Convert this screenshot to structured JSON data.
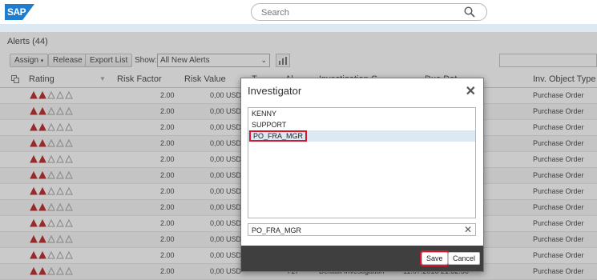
{
  "header": {
    "search_placeholder": "Search",
    "logo_text": "SAP"
  },
  "alerts": {
    "title": "Alerts (44)"
  },
  "toolbar": {
    "assign": "Assign",
    "release": "Release",
    "export": "Export List",
    "show_label": "Show:",
    "show_value": "All New Alerts"
  },
  "grid": {
    "headers": {
      "rating": "Rating",
      "risk_factor": "Risk Factor",
      "risk_value": "Risk Value",
      "type": "T",
      "alert": "Al",
      "inv": "Investigation G",
      "due": "Due Dat",
      "obj_type": "Inv. Object Type"
    },
    "rows": [
      {
        "risk_factor": "2.00",
        "risk_value": "0,00 USD",
        "due": "56",
        "obj_type": "Purchase Order"
      },
      {
        "risk_factor": "2.00",
        "risk_value": "0,00 USD",
        "due": "56",
        "obj_type": "Purchase Order"
      },
      {
        "risk_factor": "2.00",
        "risk_value": "0,00 USD",
        "due": "56",
        "obj_type": "Purchase Order"
      },
      {
        "risk_factor": "2.00",
        "risk_value": "0,00 USD",
        "due": "56",
        "obj_type": "Purchase Order"
      },
      {
        "risk_factor": "2.00",
        "risk_value": "0,00 USD",
        "due": "56",
        "obj_type": "Purchase Order"
      },
      {
        "risk_factor": "2.00",
        "risk_value": "0,00 USD",
        "due": "56",
        "obj_type": "Purchase Order"
      },
      {
        "risk_factor": "2.00",
        "risk_value": "0,00 USD",
        "due": "56",
        "obj_type": "Purchase Order"
      },
      {
        "risk_factor": "2.00",
        "risk_value": "0,00 USD",
        "due": "56",
        "obj_type": "Purchase Order"
      },
      {
        "risk_factor": "2.00",
        "risk_value": "0,00 USD",
        "due": "56",
        "obj_type": "Purchase Order"
      },
      {
        "risk_factor": "2.00",
        "risk_value": "0,00 USD",
        "due": "56",
        "obj_type": "Purchase Order"
      },
      {
        "risk_factor": "2.00",
        "risk_value": "0,00 USD",
        "due": "56",
        "obj_type": "Purchase Order"
      },
      {
        "risk_factor": "2.00",
        "risk_value": "0,00 USD",
        "alert": "717",
        "inv": "Default Investigation",
        "due": "11.07.2016 21:32:56",
        "obj_type": "Purchase Order"
      }
    ]
  },
  "dialog": {
    "title": "Investigator",
    "close": "✕",
    "items": [
      "KENNY",
      "SUPPORT",
      "PO_FRA_MGR"
    ],
    "selected_index": 2,
    "value": "PO_FRA_MGR",
    "clear": "✕",
    "save": "Save",
    "cancel": "Cancel"
  },
  "colors": {
    "accent": "#d7172f",
    "rating_fill": "#b5121b",
    "header_band": "#dce8f2"
  }
}
